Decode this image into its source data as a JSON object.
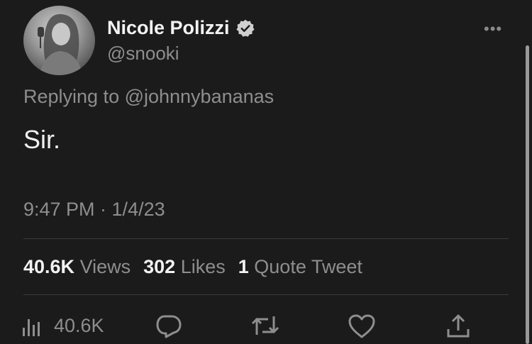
{
  "tweet": {
    "author_name": "Nicole Polizzi",
    "handle": "@snooki",
    "replying_to": "Replying to @johnnybananas",
    "text": "Sir.",
    "timestamp": "9:47 PM · 1/4/23"
  },
  "stats": {
    "views_count": "40.6K",
    "views_label": "Views",
    "likes_count": "302",
    "likes_label": "Likes",
    "quotes_count": "1",
    "quotes_label": "Quote Tweet"
  },
  "actions": {
    "views_count": "40.6K",
    "icons": [
      "analytics-icon",
      "reply-icon",
      "retweet-icon",
      "like-icon",
      "share-icon"
    ]
  },
  "menu": {
    "more_label": "•••"
  }
}
